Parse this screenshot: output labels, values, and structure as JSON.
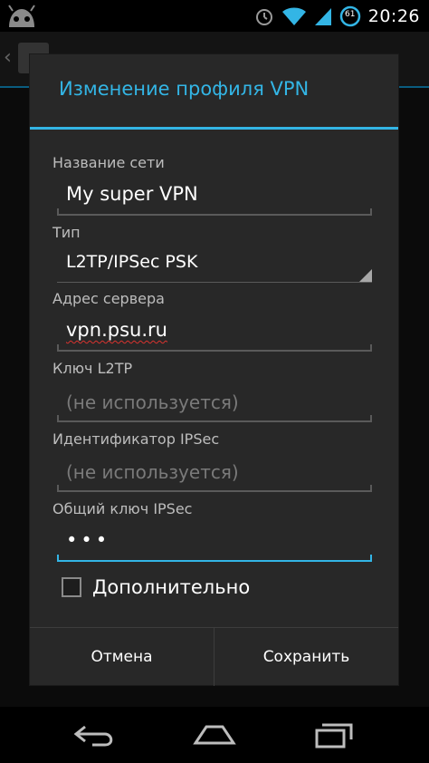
{
  "status_bar": {
    "time": "20:26",
    "battery_level": "61",
    "icons": [
      "android-icon",
      "alarm-icon",
      "wifi-icon",
      "signal-icon",
      "battery-icon"
    ]
  },
  "dialog": {
    "title": "Изменение профиля VPN",
    "fields": {
      "name": {
        "label": "Название сети",
        "value": "My super VPN"
      },
      "type": {
        "label": "Тип",
        "value": "L2TP/IPSec PSK"
      },
      "server": {
        "label": "Адрес сервера",
        "value": "vpn.psu.ru"
      },
      "l2tp_key": {
        "label": "Ключ L2TP",
        "placeholder": "(не используется)"
      },
      "ipsec_id": {
        "label": "Идентификатор IPSec",
        "placeholder": "(не используется)"
      },
      "ipsec_psk": {
        "label": "Общий ключ IPSec",
        "value": "•••"
      }
    },
    "advanced": {
      "label": "Дополнительно",
      "checked": false
    },
    "buttons": {
      "cancel": "Отмена",
      "save": "Сохранить"
    }
  },
  "colors": {
    "accent": "#33b5e5",
    "dialog_bg": "#282828",
    "spellcheck": "#d9332e"
  },
  "nav_bar": {
    "icons": [
      "back-icon",
      "home-icon",
      "recent-apps-icon"
    ]
  }
}
